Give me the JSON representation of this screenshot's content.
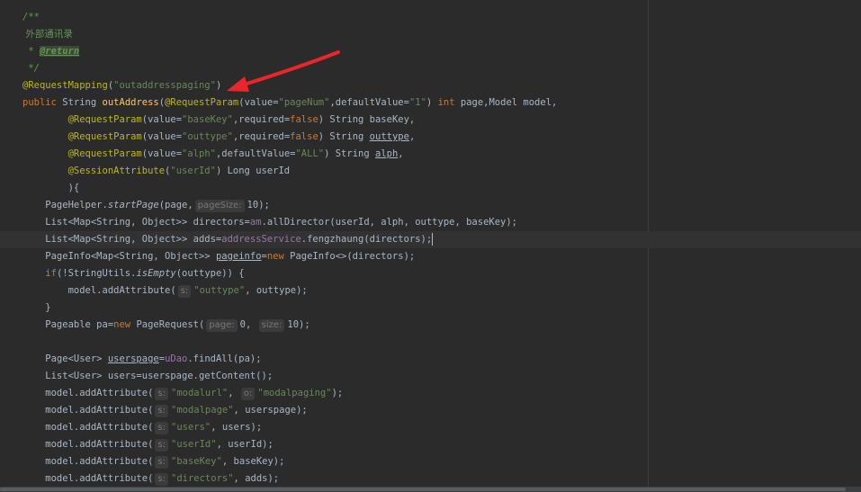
{
  "editor": {
    "lines": [
      {
        "segs": [
          [
            "cmt",
            "/**"
          ]
        ]
      },
      {
        "segs": [
          [
            "cmt-cn",
            " 外部通讯录"
          ]
        ]
      },
      {
        "segs": [
          [
            "cmt",
            " * "
          ],
          [
            "tag",
            "@return"
          ]
        ]
      },
      {
        "segs": [
          [
            "cmt",
            " */"
          ]
        ]
      },
      {
        "segs": [
          [
            "ann",
            "@RequestMapping"
          ],
          [
            "",
            "("
          ],
          [
            "str",
            "\"outaddresspaging\""
          ],
          [
            "",
            ")"
          ]
        ]
      },
      {
        "segs": [
          [
            "kw",
            "public "
          ],
          [
            "",
            "String "
          ],
          [
            "mth",
            "outAddress"
          ],
          [
            "",
            "("
          ],
          [
            "ann",
            "@RequestParam"
          ],
          [
            "",
            "(value="
          ],
          [
            "str",
            "\"pageNum\""
          ],
          [
            "",
            ",defaultValue="
          ],
          [
            "str",
            "\"1\""
          ],
          [
            "",
            ") "
          ],
          [
            "kw",
            "int "
          ],
          [
            "",
            "page,Model model,"
          ]
        ]
      },
      {
        "segs": [
          [
            "",
            "        "
          ],
          [
            "ann",
            "@RequestParam"
          ],
          [
            "",
            "(value="
          ],
          [
            "str",
            "\"baseKey\""
          ],
          [
            "",
            ",required="
          ],
          [
            "kw",
            "false"
          ],
          [
            "",
            ") String baseKey,"
          ]
        ]
      },
      {
        "segs": [
          [
            "",
            "        "
          ],
          [
            "ann",
            "@RequestParam"
          ],
          [
            "",
            "(value="
          ],
          [
            "str",
            "\"outtype\""
          ],
          [
            "",
            ",required="
          ],
          [
            "kw",
            "false"
          ],
          [
            "",
            ") String "
          ],
          [
            "under",
            "outtype"
          ],
          [
            "",
            ","
          ]
        ]
      },
      {
        "segs": [
          [
            "",
            "        "
          ],
          [
            "ann",
            "@RequestParam"
          ],
          [
            "",
            "(value="
          ],
          [
            "str",
            "\"alph\""
          ],
          [
            "",
            ",defaultValue="
          ],
          [
            "str",
            "\"ALL\""
          ],
          [
            "",
            ") String "
          ],
          [
            "under",
            "alph"
          ],
          [
            "",
            ","
          ]
        ]
      },
      {
        "segs": [
          [
            "",
            "        "
          ],
          [
            "ann",
            "@SessionAttribute"
          ],
          [
            "",
            "("
          ],
          [
            "str",
            "\"userId\""
          ],
          [
            "",
            ") Long userId"
          ]
        ]
      },
      {
        "segs": [
          [
            "",
            "        ){"
          ]
        ]
      },
      {
        "segs": [
          [
            "",
            "    PageHelper."
          ],
          [
            "ital",
            "startPage"
          ],
          [
            "",
            "(page,"
          ],
          [
            "hint",
            "pageSize:"
          ],
          [
            "",
            "10);"
          ]
        ]
      },
      {
        "segs": [
          [
            "",
            "    List<Map<String, Object>> directors="
          ],
          [
            "fld",
            "am"
          ],
          [
            "",
            ".allDirector(userId, alph, outtype, baseKey);"
          ]
        ]
      },
      {
        "segs": [
          [
            "",
            "    List<Map<String, Object>> adds="
          ],
          [
            "fld",
            "addressService"
          ],
          [
            "",
            ".fengzhaung(directors);"
          ],
          [
            "caret",
            ""
          ]
        ],
        "current": true
      },
      {
        "segs": [
          [
            "",
            "    PageInfo<Map<String, Object>> "
          ],
          [
            "under",
            "pageinfo"
          ],
          [
            "",
            "="
          ],
          [
            "kw",
            "new "
          ],
          [
            "",
            "PageInfo<>(directors);"
          ]
        ]
      },
      {
        "segs": [
          [
            "",
            "    "
          ],
          [
            "kw",
            "if"
          ],
          [
            "",
            "(!StringUtils."
          ],
          [
            "ital",
            "isEmpty"
          ],
          [
            "",
            "(outtype)) {"
          ]
        ]
      },
      {
        "segs": [
          [
            "",
            "        model.addAttribute("
          ],
          [
            "hint",
            "s:"
          ],
          [
            "str",
            "\"outtype\""
          ],
          [
            "",
            ", outtype);"
          ]
        ]
      },
      {
        "segs": [
          [
            "",
            "    }"
          ]
        ]
      },
      {
        "segs": [
          [
            "",
            "    Pageable pa="
          ],
          [
            "kw",
            "new "
          ],
          [
            "",
            "PageRequest("
          ],
          [
            "hint",
            "page:"
          ],
          [
            "",
            "0, "
          ],
          [
            "hint",
            "size:"
          ],
          [
            "",
            "10);"
          ]
        ]
      },
      {
        "segs": [
          [
            "",
            ""
          ]
        ]
      },
      {
        "segs": [
          [
            "",
            "    Page<User> "
          ],
          [
            "under",
            "userspage"
          ],
          [
            "",
            "="
          ],
          [
            "fld",
            "uDao"
          ],
          [
            "",
            ".findAll(pa);"
          ]
        ]
      },
      {
        "segs": [
          [
            "",
            "    List<User> users=userspage.getContent();"
          ]
        ]
      },
      {
        "segs": [
          [
            "",
            "    model.addAttribute("
          ],
          [
            "hint",
            "s:"
          ],
          [
            "str",
            "\"modalurl\""
          ],
          [
            "",
            ", "
          ],
          [
            "hint",
            "o:"
          ],
          [
            "str",
            "\"modalpaging\""
          ],
          [
            "",
            ");"
          ]
        ]
      },
      {
        "segs": [
          [
            "",
            "    model.addAttribute("
          ],
          [
            "hint",
            "s:"
          ],
          [
            "str",
            "\"modalpage\""
          ],
          [
            "",
            ", userspage);"
          ]
        ]
      },
      {
        "segs": [
          [
            "",
            "    model.addAttribute("
          ],
          [
            "hint",
            "s:"
          ],
          [
            "str",
            "\"users\""
          ],
          [
            "",
            ", users);"
          ]
        ]
      },
      {
        "segs": [
          [
            "",
            "    model.addAttribute("
          ],
          [
            "hint",
            "s:"
          ],
          [
            "str",
            "\"userId\""
          ],
          [
            "",
            ", userId);"
          ]
        ]
      },
      {
        "segs": [
          [
            "",
            "    model.addAttribute("
          ],
          [
            "hint",
            "s:"
          ],
          [
            "str",
            "\"baseKey\""
          ],
          [
            "",
            ", baseKey);"
          ]
        ]
      },
      {
        "segs": [
          [
            "",
            "    model.addAttribute("
          ],
          [
            "hint",
            "s:"
          ],
          [
            "str",
            "\"directors\""
          ],
          [
            "",
            ", adds);"
          ]
        ]
      }
    ]
  },
  "annotation": {
    "arrow_color": "#e8262b",
    "arrow_icon": "red-arrow-icon"
  },
  "colors": {
    "background": "#2b2b2b",
    "keyword": "#cc7832",
    "string": "#6a8759",
    "annotation": "#bbb529",
    "comment": "#629755",
    "field": "#9876aa",
    "method": "#ffc66d"
  }
}
